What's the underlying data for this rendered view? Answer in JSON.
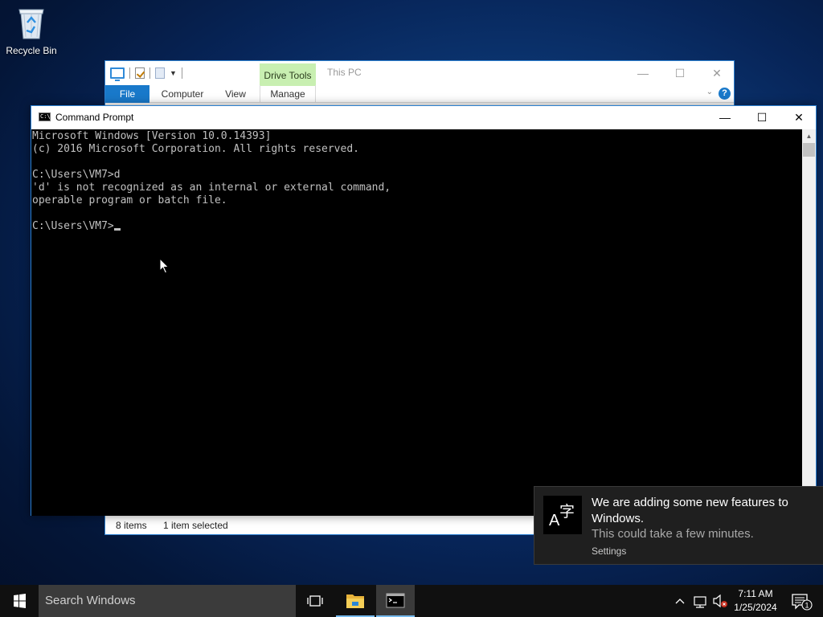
{
  "desktop": {
    "icons": [
      {
        "label": "Recycle Bin",
        "icon": "recycle-bin-icon"
      }
    ]
  },
  "explorer": {
    "contextual_tab_group": "Drive Tools",
    "title": "This PC",
    "tabs": [
      "File",
      "Computer",
      "View",
      "Manage"
    ],
    "status": {
      "items": "8 items",
      "selected": "1 item selected"
    },
    "controls": {
      "minimize": "—",
      "maximize": "☐",
      "close": "✕"
    },
    "help_label": "?"
  },
  "cmd": {
    "title": "Command Prompt",
    "lines": [
      "Microsoft Windows [Version 10.0.14393]",
      "(c) 2016 Microsoft Corporation. All rights reserved.",
      "",
      "C:\\Users\\VM7>d",
      "'d' is not recognized as an internal or external command,",
      "operable program or batch file.",
      "",
      "C:\\Users\\VM7>"
    ],
    "controls": {
      "minimize": "—",
      "maximize": "☐",
      "close": "✕"
    }
  },
  "toast": {
    "app_icon": "language-icon",
    "title": "We are adding some new features to Windows.",
    "body": "This could take a few minutes.",
    "attribution": "Settings"
  },
  "taskbar": {
    "search_placeholder": "Search Windows",
    "pinned": [
      {
        "name": "task-view",
        "icon": "task-view-icon",
        "active": false
      },
      {
        "name": "file-explorer",
        "icon": "folder-icon",
        "active": true
      },
      {
        "name": "command-prompt",
        "icon": "cmd-icon",
        "active": true
      }
    ],
    "tray": {
      "icons": [
        "chevron-up-icon",
        "network-icon",
        "volume-muted-icon"
      ],
      "time": "7:11 AM",
      "date": "1/25/2024",
      "notification_count": "1"
    }
  },
  "colors": {
    "accent": "#1979ca",
    "drive_tools": "#c8efb1",
    "console_bg": "#000000",
    "console_fg": "#c0c0c0",
    "taskbar_bg": "#101010"
  }
}
